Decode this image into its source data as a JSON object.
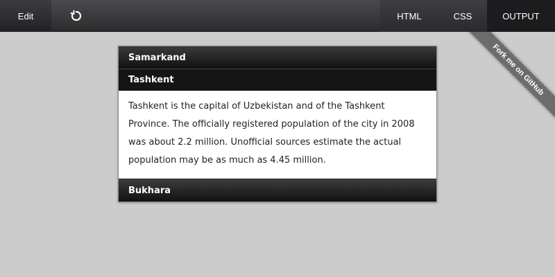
{
  "toolbar": {
    "edit_label": "Edit",
    "refresh_icon": "refresh-icon",
    "tabs": [
      {
        "label": "HTML"
      },
      {
        "label": "CSS"
      },
      {
        "label": "OUTPUT"
      }
    ]
  },
  "accordion": {
    "items": [
      {
        "title": "Samarkand"
      },
      {
        "title": "Tashkent",
        "content": "Tashkent is the capital of Uzbekistan and of the Tashkent Province. The officially registered population of the city in 2008 was about 2.2 million. Unofficial sources estimate the actual population may be as much as 4.45 million."
      },
      {
        "title": "Bukhara"
      }
    ]
  },
  "ribbon": {
    "label": "Fork me on GitHub"
  },
  "colors": {
    "background": "#cccccc",
    "toolbar": "#2c2c2f",
    "active_tab": "#1c1c1e",
    "ribbon": "#6c6c6c"
  }
}
